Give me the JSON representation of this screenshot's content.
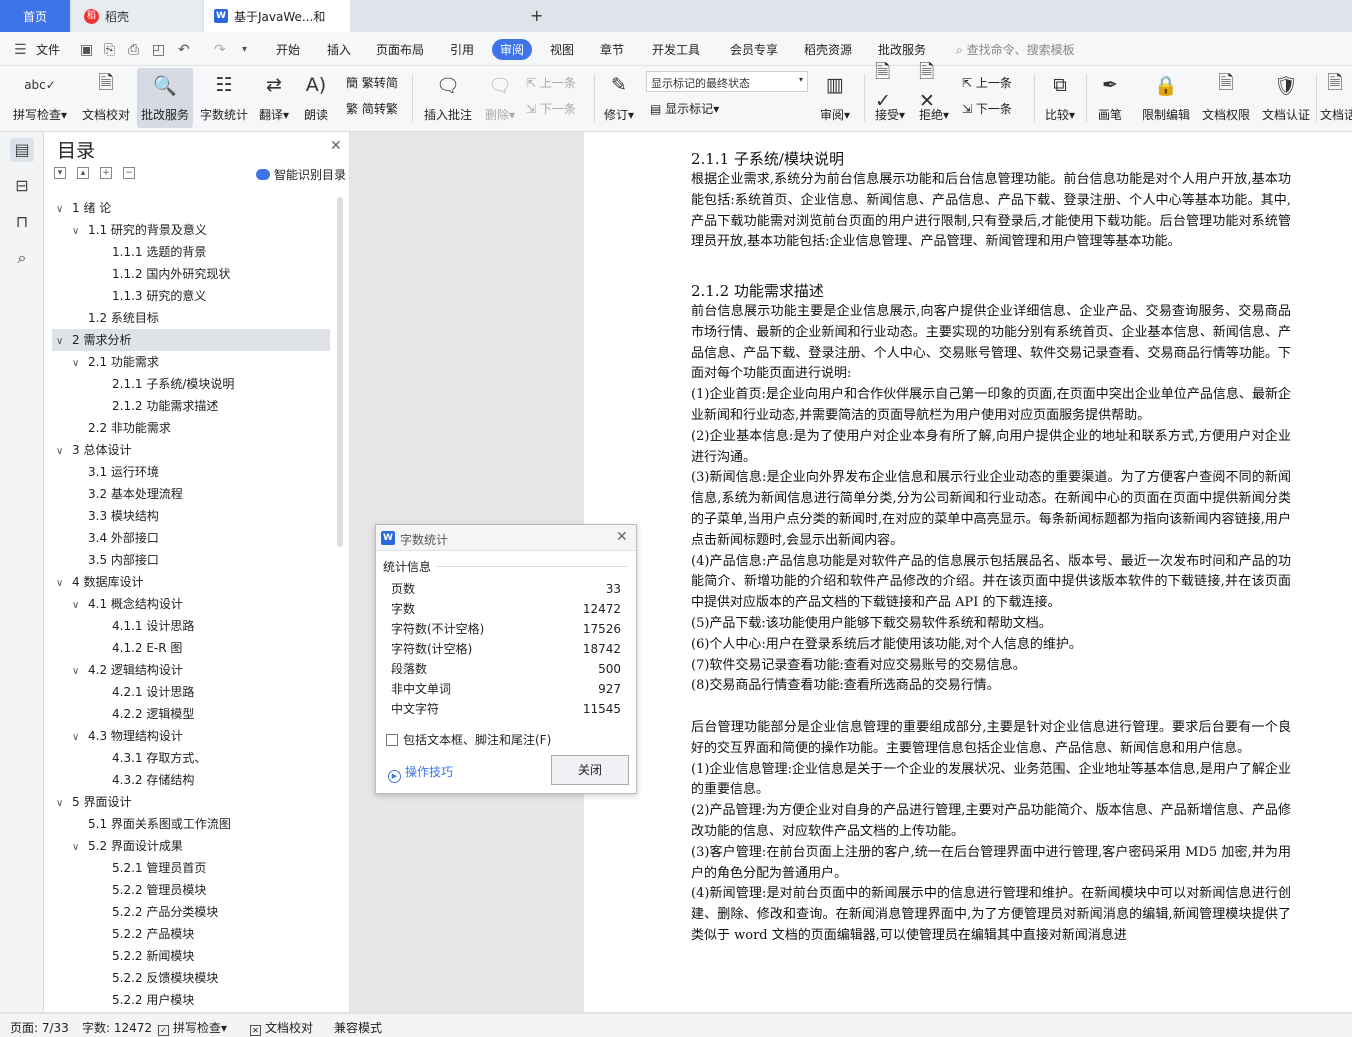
{
  "tabs": {
    "home": "首页",
    "daoke": "稻壳",
    "doc": "基于JavaWe...和"
  },
  "menu": [
    "文件",
    "开始",
    "插入",
    "页面布局",
    "引用",
    "审阅",
    "视图",
    "章节",
    "开发工具",
    "会员专享",
    "稻壳资源",
    "批改服务"
  ],
  "menu_active": "审阅",
  "search_placeholder": "查找命令、搜索模板",
  "ribbon": {
    "spell": "拼写检查",
    "proof": "文档校对",
    "grade": "批改服务",
    "count": "字数统计",
    "translate": "翻译",
    "read": "朗读",
    "trad": "繁转简",
    "simp": "简转繁",
    "insert_comment": "插入批注",
    "delete": "删除",
    "prev": "上一条",
    "next": "下一条",
    "revise": "修订",
    "markup_select": "显示标记的最终状态",
    "show_markup": "显示标记",
    "review": "审阅",
    "accept": "接受",
    "reject": "拒绝",
    "prev2": "上一条",
    "next2": "下一条",
    "compare": "比较",
    "pen": "画笔",
    "restrict": "限制编辑",
    "perm": "文档权限",
    "cert": "文档认证",
    "more": "文档话"
  },
  "toc": {
    "title": "目录",
    "smart": "智能识别目录",
    "items": [
      {
        "label": "1 绪 论",
        "level": 1,
        "arrow": true
      },
      {
        "label": "1.1 研究的背景及意义",
        "level": 2,
        "arrow": true
      },
      {
        "label": "1.1.1 选题的背景",
        "level": 3
      },
      {
        "label": "1.1.2 国内外研究现状",
        "level": 3
      },
      {
        "label": "1.1.3 研究的意义",
        "level": 3
      },
      {
        "label": "1.2 系统目标",
        "level": 2
      },
      {
        "label": "2 需求分析",
        "level": 1,
        "arrow": true,
        "selected": true
      },
      {
        "label": "2.1 功能需求",
        "level": 2,
        "arrow": true
      },
      {
        "label": "2.1.1 子系统/模块说明",
        "level": 3
      },
      {
        "label": "2.1.2 功能需求描述",
        "level": 3
      },
      {
        "label": "2.2 非功能需求",
        "level": 2
      },
      {
        "label": "3 总体设计",
        "level": 1,
        "arrow": true
      },
      {
        "label": "3.1 运行环境",
        "level": 2
      },
      {
        "label": "3.2 基本处理流程",
        "level": 2
      },
      {
        "label": "3.3 模块结构",
        "level": 2
      },
      {
        "label": "3.4 外部接口",
        "level": 2
      },
      {
        "label": "3.5 内部接口",
        "level": 2
      },
      {
        "label": "4 数据库设计",
        "level": 1,
        "arrow": true
      },
      {
        "label": "4.1 概念结构设计",
        "level": 2,
        "arrow": true
      },
      {
        "label": "4.1.1 设计思路",
        "level": 3
      },
      {
        "label": "4.1.2 E-R 图",
        "level": 3
      },
      {
        "label": "4.2 逻辑结构设计",
        "level": 2,
        "arrow": true
      },
      {
        "label": "4.2.1 设计思路",
        "level": 3
      },
      {
        "label": "4.2.2 逻辑模型",
        "level": 3
      },
      {
        "label": "4.3 物理结构设计",
        "level": 2,
        "arrow": true
      },
      {
        "label": "4.3.1 存取方式、",
        "level": 3
      },
      {
        "label": "4.3.2 存储结构",
        "level": 3
      },
      {
        "label": "5 界面设计",
        "level": 1,
        "arrow": true
      },
      {
        "label": "5.1 界面关系图或工作流图",
        "level": 2
      },
      {
        "label": "5.2 界面设计成果",
        "level": 2,
        "arrow": true
      },
      {
        "label": "5.2.1 管理员首页",
        "level": 3
      },
      {
        "label": "5.2.2 管理员模块",
        "level": 3
      },
      {
        "label": "5.2.2 产品分类模块",
        "level": 3
      },
      {
        "label": "5.2.2 产品模块",
        "level": 3
      },
      {
        "label": "5.2.2 新闻模块",
        "level": 3
      },
      {
        "label": "5.2.2 反馈模块模块",
        "level": 3
      },
      {
        "label": "5.2.2 用户模块",
        "level": 3
      }
    ]
  },
  "doc": {
    "blocks": [
      {
        "t": "h",
        "text": "2.1.1 子系统/模块说明"
      },
      {
        "t": "p",
        "text": "根据企业需求,系统分为前台信息展示功能和后台信息管理功能。前台信息功能是对个人用户开放,基本功能包括:系统首页、企业信息、新闻信息、产品信息、产品下载、登录注册、个人中心等基本功能。其中,产品下载功能需对浏览前台页面的用户进行限制,只有登录后,才能使用下载功能。后台管理功能对系统管理员开放,基本功能包括:企业信息管理、产品管理、新闻管理和用户管理等基本功能。"
      },
      {
        "t": "b"
      },
      {
        "t": "h",
        "text": "2.1.2 功能需求描述"
      },
      {
        "t": "p",
        "text": "前台信息展示功能主要是企业信息展示,向客户提供企业详细信息、企业产品、交易查询服务、交易商品市场行情、最新的企业新闻和行业动态。主要实现的功能分别有系统首页、企业基本信息、新闻信息、产品信息、产品下载、登录注册、个人中心、交易账号管理、软件交易记录查看、交易商品行情等功能。下面对每个功能页面进行说明:"
      },
      {
        "t": "p",
        "text": "(1)企业首页:是企业向用户和合作伙伴展示自己第一印象的页面,在页面中突出企业单位产品信息、最新企业新闻和行业动态,并需要简洁的页面导航栏为用户使用对应页面服务提供帮助。"
      },
      {
        "t": "p",
        "text": "(2)企业基本信息:是为了使用户对企业本身有所了解,向用户提供企业的地址和联系方式,方便用户对企业进行沟通。"
      },
      {
        "t": "p",
        "text": "(3)新闻信息:是企业向外界发布企业信息和展示行业企业动态的重要渠道。为了方便客户查阅不同的新闻信息,系统为新闻信息进行简单分类,分为公司新闻和行业动态。在新闻中心的页面在页面中提供新闻分类的子菜单,当用户点分类的新闻时,在对应的菜单中高亮显示。每条新闻标题都为指向该新闻内容链接,用户点击新闻标题时,会显示出新闻内容。"
      },
      {
        "t": "p",
        "text": "(4)产品信息:产品信息功能是对软件产品的信息展示包括展品名、版本号、最近一次发布时间和产品的功能简介、新增功能的介绍和软件产品修改的介绍。并在该页面中提供该版本软件的下载链接,并在该页面中提供对应版本的产品文档的下载链接和产品 API 的下载连接。"
      },
      {
        "t": "p",
        "text": "(5)产品下载:该功能使用户能够下载交易软件系统和帮助文档。"
      },
      {
        "t": "p",
        "text": "(6)个人中心:用户在登录系统后才能使用该功能,对个人信息的维护。"
      },
      {
        "t": "p",
        "text": "(7)软件交易记录查看功能:查看对应交易账号的交易信息。"
      },
      {
        "t": "p",
        "text": "(8)交易商品行情查看功能:查看所选商品的交易行情。"
      },
      {
        "t": "b"
      },
      {
        "t": "p",
        "text": "后台管理功能部分是企业信息管理的重要组成部分,主要是针对企业信息进行管理。要求后台要有一个良好的交互界面和简便的操作功能。主要管理信息包括企业信息、产品信息、新闻信息和用户信息。"
      },
      {
        "t": "p",
        "text": "(1)企业信息管理:企业信息是关于一个企业的发展状况、业务范围、企业地址等基本信息,是用户了解企业的重要信息。"
      },
      {
        "t": "p",
        "text": "(2)产品管理:为方便企业对自身的产品进行管理,主要对产品功能简介、版本信息、产品新增信息、产品修改功能的信息、对应软件产品文档的上传功能。"
      },
      {
        "t": "p",
        "text": "(3)客户管理:在前台页面上注册的客户,统一在后台管理界面中进行管理,客户密码采用 MD5 加密,并为用户的角色分配为普通用户。"
      },
      {
        "t": "p",
        "text": "(4)新闻管理:是对前台页面中的新闻展示中的信息进行管理和维护。在新闻模块中可以对新闻信息进行创建、删除、修改和查询。在新闻消息管理界面中,为了方便管理员对新闻消息的编辑,新闻管理模块提供了类似于 word 文档的页面编辑器,可以使管理员在编辑其中直接对新闻消息进"
      }
    ]
  },
  "dialog": {
    "title": "字数统计",
    "section": "统计信息",
    "rows": [
      {
        "k": "页数",
        "v": "33"
      },
      {
        "k": "字数",
        "v": "12472"
      },
      {
        "k": "字符数(不计空格)",
        "v": "17526"
      },
      {
        "k": "字符数(计空格)",
        "v": "18742"
      },
      {
        "k": "段落数",
        "v": "500"
      },
      {
        "k": "非中文单词",
        "v": "927"
      },
      {
        "k": "中文字符",
        "v": "11545"
      }
    ],
    "include": "包括文本框、脚注和尾注(F)",
    "tips": "操作技巧",
    "close": "关闭"
  },
  "status": {
    "page": "页面: 7/33",
    "words": "字数: 12472",
    "spell": "拼写检查",
    "proof": "文档校对",
    "compat": "兼容模式"
  },
  "colors": {
    "accent": "#3f74e8"
  }
}
